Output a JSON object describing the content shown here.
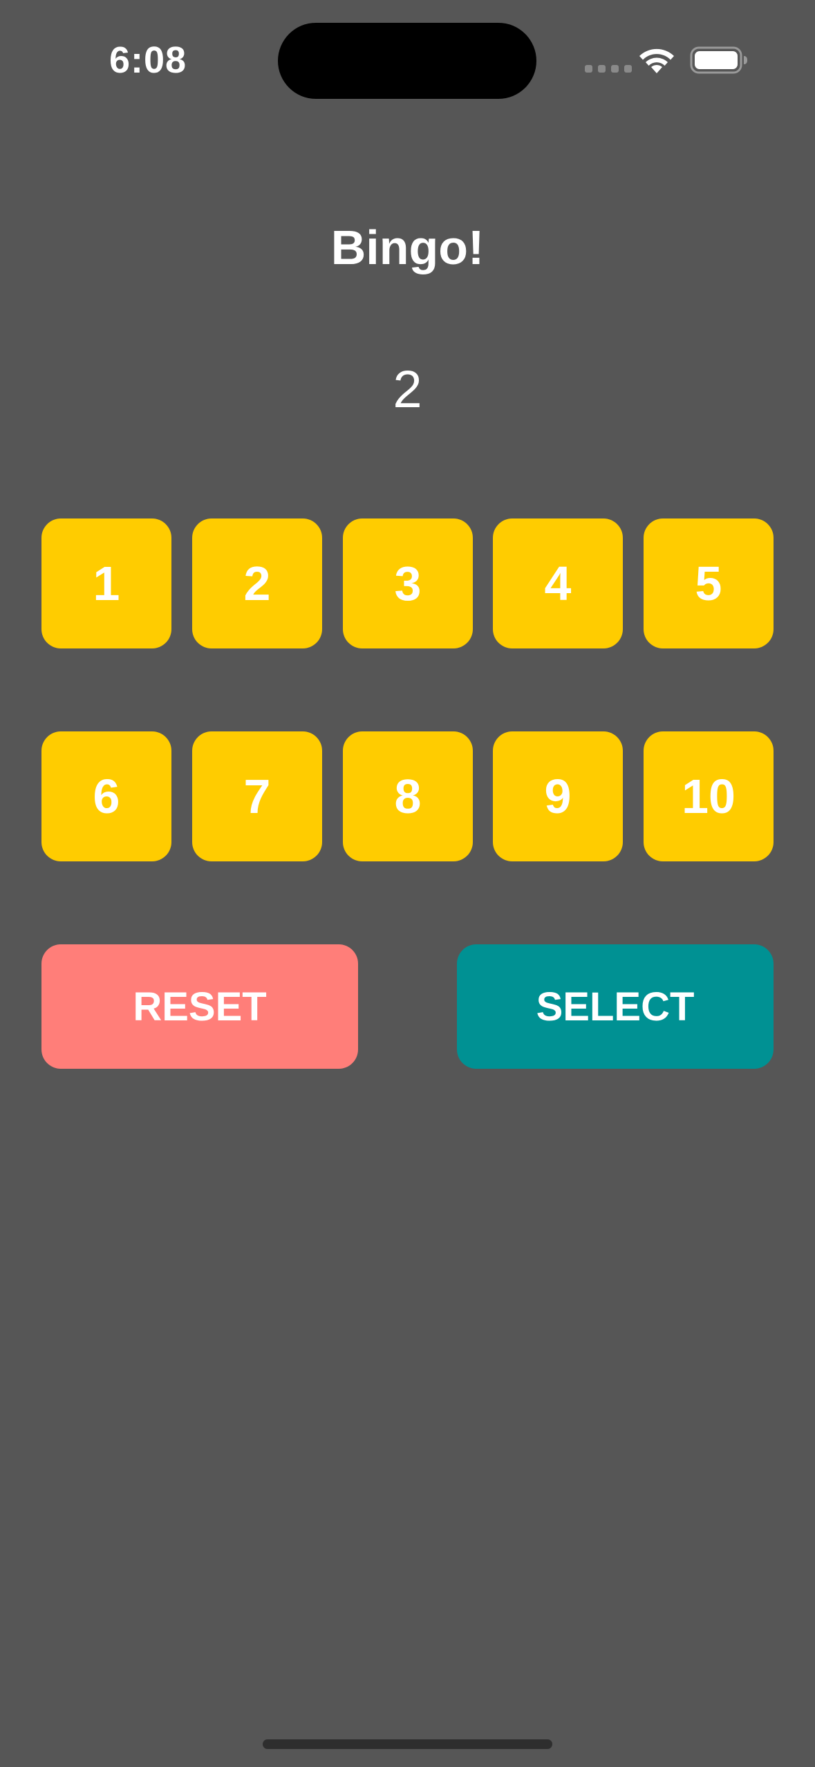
{
  "status_bar": {
    "time": "6:08",
    "icons": [
      "signal-dots-icon",
      "wifi-icon",
      "battery-icon"
    ]
  },
  "title": "Bingo!",
  "current_number": "2",
  "grid": {
    "row1": [
      "1",
      "2",
      "3",
      "4",
      "5"
    ],
    "row2": [
      "6",
      "7",
      "8",
      "9",
      "10"
    ]
  },
  "buttons": {
    "reset": "RESET",
    "select": "SELECT"
  },
  "colors": {
    "background": "#565656",
    "tile": "#ffcc00",
    "reset": "#ff7e79",
    "select": "#009193"
  }
}
